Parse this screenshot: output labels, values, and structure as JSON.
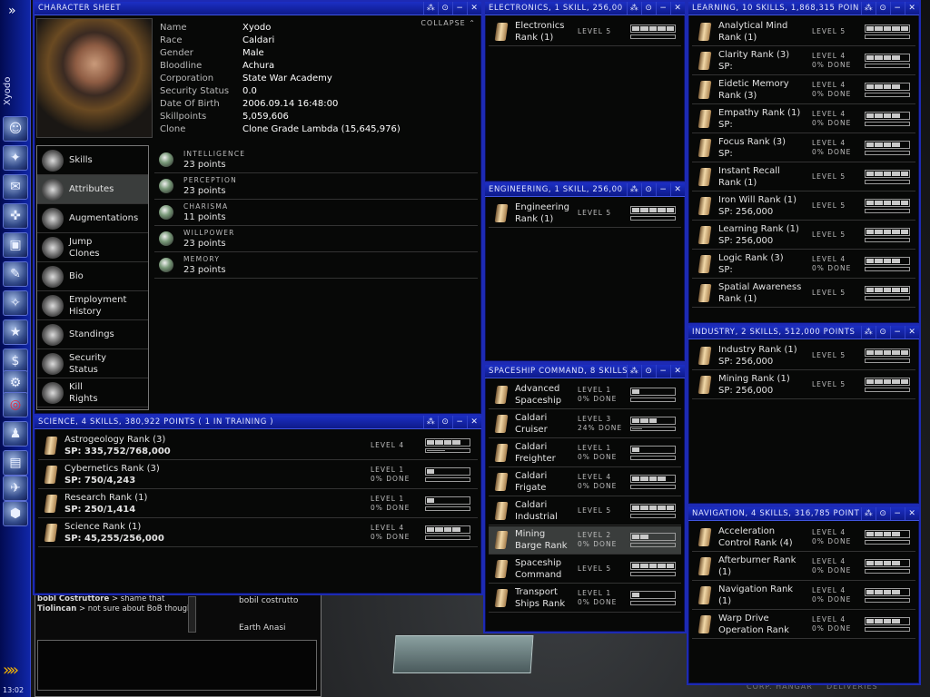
{
  "sidebar": {
    "pilot_name": "Xyodo",
    "clock": "13:02",
    "expand_icon": "double-chevron-icon"
  },
  "charsheet": {
    "title": "CHARACTER SHEET",
    "collapse": "COLLAPSE",
    "info": [
      {
        "k": "Name",
        "v": "Xyodo"
      },
      {
        "k": "Race",
        "v": "Caldari"
      },
      {
        "k": "Gender",
        "v": "Male"
      },
      {
        "k": "Bloodline",
        "v": "Achura"
      },
      {
        "k": "Corporation",
        "v": "State War Academy"
      },
      {
        "k": "Security Status",
        "v": "0.0"
      },
      {
        "k": "Date Of Birth",
        "v": "2006.09.14 16:48:00"
      },
      {
        "k": "Skillpoints",
        "v": "5,059,606"
      },
      {
        "k": "Clone",
        "v": "Clone Grade Lambda (15,645,976)"
      }
    ],
    "nav": [
      "Skills",
      "Attributes",
      "Augmentations",
      "Jump\nClones",
      "Bio",
      "Employment\nHistory",
      "Standings",
      "Security\nStatus",
      "Kill\nRights"
    ],
    "attributes": [
      {
        "name": "INTELLIGENCE",
        "value": "23 points"
      },
      {
        "name": "PERCEPTION",
        "value": "23 points"
      },
      {
        "name": "CHARISMA",
        "value": "11 points"
      },
      {
        "name": "WILLPOWER",
        "value": "23 points"
      },
      {
        "name": "MEMORY",
        "value": "23 points"
      }
    ]
  },
  "science": {
    "title": "SCIENCE, 4 SKILLS, 380,922 POINTS ( 1 IN TRAINING )",
    "skills": [
      {
        "name": "Astrogeology Rank (3)",
        "sp": "SP: 335,752/768,000",
        "level": "LEVEL 4",
        "done": "",
        "fill": 4,
        "progress": 0.44
      },
      {
        "name": "Cybernetics Rank (3)",
        "sp": "SP: 750/4,243",
        "level": "LEVEL 1",
        "done": "0% DONE",
        "fill": 1,
        "progress": 0
      },
      {
        "name": "Research Rank (1)",
        "sp": "SP: 250/1,414",
        "level": "LEVEL 1",
        "done": "0% DONE",
        "fill": 1,
        "progress": 0
      },
      {
        "name": "Science Rank (1)",
        "sp": "SP: 45,255/256,000",
        "level": "LEVEL 4",
        "done": "0% DONE",
        "fill": 4,
        "progress": 0
      }
    ]
  },
  "electronics": {
    "title": "ELECTRONICS, 1 SKILL, 256,00",
    "skills": [
      {
        "name": "Electronics\nRank (1)",
        "level": "LEVEL 5",
        "done": "",
        "fill": 5,
        "progress": 0
      }
    ]
  },
  "engineering": {
    "title": "ENGINEERING, 1 SKILL, 256,00",
    "skills": [
      {
        "name": "Engineering\nRank (1)",
        "level": "LEVEL 5",
        "done": "",
        "fill": 5,
        "progress": 0
      }
    ]
  },
  "spaceship": {
    "title": "SPACESHIP COMMAND, 8 SKILLS",
    "skills": [
      {
        "name": "Advanced\nSpaceship",
        "level": "LEVEL 1",
        "done": "0% DONE",
        "fill": 1,
        "progress": 0
      },
      {
        "name": "Caldari\nCruiser",
        "level": "LEVEL 3",
        "done": "24% DONE",
        "fill": 3,
        "progress": 0.24
      },
      {
        "name": "Caldari\nFreighter",
        "level": "LEVEL 1",
        "done": "0% DONE",
        "fill": 1,
        "progress": 0
      },
      {
        "name": "Caldari\nFrigate",
        "level": "LEVEL 4",
        "done": "0% DONE",
        "fill": 4,
        "progress": 0
      },
      {
        "name": "Caldari\nIndustrial",
        "level": "LEVEL 5",
        "done": "",
        "fill": 5,
        "progress": 0
      },
      {
        "name": "Mining\nBarge Rank",
        "level": "LEVEL 2",
        "done": "0% DONE",
        "fill": 2,
        "progress": 0,
        "selected": true
      },
      {
        "name": "Spaceship\nCommand",
        "level": "LEVEL 5",
        "done": "",
        "fill": 5,
        "progress": 0
      },
      {
        "name": "Transport\nShips Rank",
        "level": "LEVEL 1",
        "done": "0% DONE",
        "fill": 1,
        "progress": 0
      }
    ]
  },
  "learning": {
    "title": "LEARNING, 10 SKILLS, 1,868,315 POIN",
    "skills": [
      {
        "name": "Analytical Mind\nRank (1)",
        "level": "LEVEL 5",
        "done": "",
        "fill": 5,
        "progress": 0
      },
      {
        "name": "Clarity Rank (3)\nSP:",
        "level": "LEVEL 4",
        "done": "0% DONE",
        "fill": 4,
        "progress": 0
      },
      {
        "name": "Eidetic Memory\nRank (3)",
        "level": "LEVEL 4",
        "done": "0% DONE",
        "fill": 4,
        "progress": 0
      },
      {
        "name": "Empathy Rank (1)\nSP:",
        "level": "LEVEL 4",
        "done": "0% DONE",
        "fill": 4,
        "progress": 0
      },
      {
        "name": "Focus Rank (3)\nSP:",
        "level": "LEVEL 4",
        "done": "0% DONE",
        "fill": 4,
        "progress": 0
      },
      {
        "name": "Instant Recall\nRank (1)",
        "level": "LEVEL 5",
        "done": "",
        "fill": 5,
        "progress": 0
      },
      {
        "name": "Iron Will Rank (1)\nSP: 256,000",
        "level": "LEVEL 5",
        "done": "",
        "fill": 5,
        "progress": 0
      },
      {
        "name": "Learning Rank (1)\nSP: 256,000",
        "level": "LEVEL 5",
        "done": "",
        "fill": 5,
        "progress": 0
      },
      {
        "name": "Logic Rank (3)\nSP:",
        "level": "LEVEL 4",
        "done": "0% DONE",
        "fill": 4,
        "progress": 0
      },
      {
        "name": "Spatial Awareness\nRank (1)",
        "level": "LEVEL 5",
        "done": "",
        "fill": 5,
        "progress": 0
      }
    ]
  },
  "industry": {
    "title": "INDUSTRY, 2 SKILLS, 512,000 POINTS",
    "skills": [
      {
        "name": "Industry Rank (1)\nSP: 256,000",
        "level": "LEVEL 5",
        "done": "",
        "fill": 5,
        "progress": 0
      },
      {
        "name": "Mining Rank (1)\nSP: 256,000",
        "level": "LEVEL 5",
        "done": "",
        "fill": 5,
        "progress": 0
      }
    ]
  },
  "navigation": {
    "title": "NAVIGATION, 4 SKILLS, 316,785 POINT",
    "skills": [
      {
        "name": "Acceleration\nControl Rank (4)",
        "level": "LEVEL 4",
        "done": "0% DONE",
        "fill": 4,
        "progress": 0
      },
      {
        "name": "Afterburner Rank\n(1)",
        "level": "LEVEL 4",
        "done": "0% DONE",
        "fill": 4,
        "progress": 0
      },
      {
        "name": "Navigation Rank\n(1)",
        "level": "LEVEL 4",
        "done": "0% DONE",
        "fill": 4,
        "progress": 0
      },
      {
        "name": "Warp Drive\nOperation Rank",
        "level": "LEVEL 4",
        "done": "0% DONE",
        "fill": 4,
        "progress": 0
      }
    ]
  },
  "chat": {
    "lines": [
      {
        "who": "bobl Costruttore",
        "msg": "> shame that"
      },
      {
        "who": "Tiolincan",
        "msg": "> not sure about BoB though"
      }
    ],
    "members": [
      "bobil costrutto",
      "Earth Anasi"
    ]
  },
  "background": {
    "hangar_a": "CORP. HANGAR",
    "hangar_b": "DELIVERIES"
  }
}
